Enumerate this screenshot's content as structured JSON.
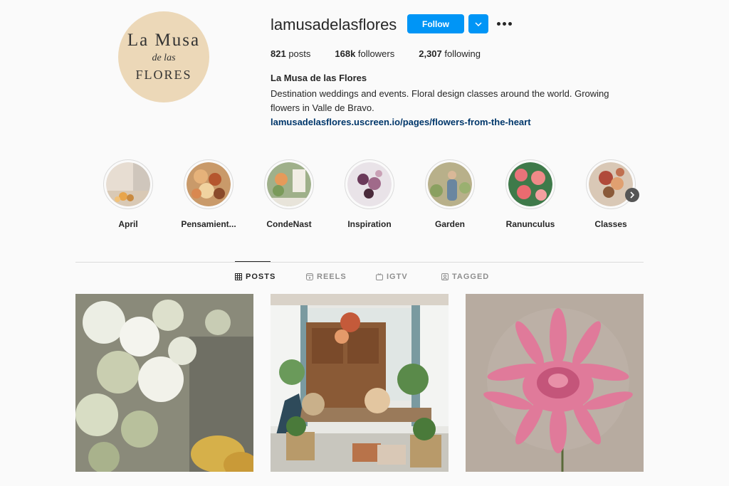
{
  "profile": {
    "logo_line1": "La Musa",
    "logo_line2": "de las",
    "logo_line3": "FLORES",
    "username": "lamusadelasflores",
    "follow_label": "Follow",
    "posts_count": "821",
    "posts_label": " posts",
    "followers_count": "168k",
    "followers_label": " followers",
    "following_count": "2,307",
    "following_label": " following",
    "full_name": "La Musa de las Flores",
    "bio": "Destination weddings and events. Floral design classes around the world. Growing flowers in Valle de Bravo.",
    "link": "lamusadelasflores.uscreen.io/pages/flowers-from-the-heart"
  },
  "highlights": [
    {
      "label": "April"
    },
    {
      "label": "Pensamient..."
    },
    {
      "label": "CondeNast"
    },
    {
      "label": "Inspiration"
    },
    {
      "label": "Garden"
    },
    {
      "label": "Ranunculus"
    },
    {
      "label": "Classes"
    }
  ],
  "tabs": [
    {
      "label": "POSTS",
      "icon": "grid-icon",
      "active": true
    },
    {
      "label": "REELS",
      "icon": "reels-icon",
      "active": false
    },
    {
      "label": "IGTV",
      "icon": "igtv-icon",
      "active": false
    },
    {
      "label": "TAGGED",
      "icon": "tagged-icon",
      "active": false
    }
  ],
  "colors": {
    "accent": "#0095f6",
    "link": "#00376b",
    "background": "#fafafa",
    "muted": "#8e8e8e"
  }
}
